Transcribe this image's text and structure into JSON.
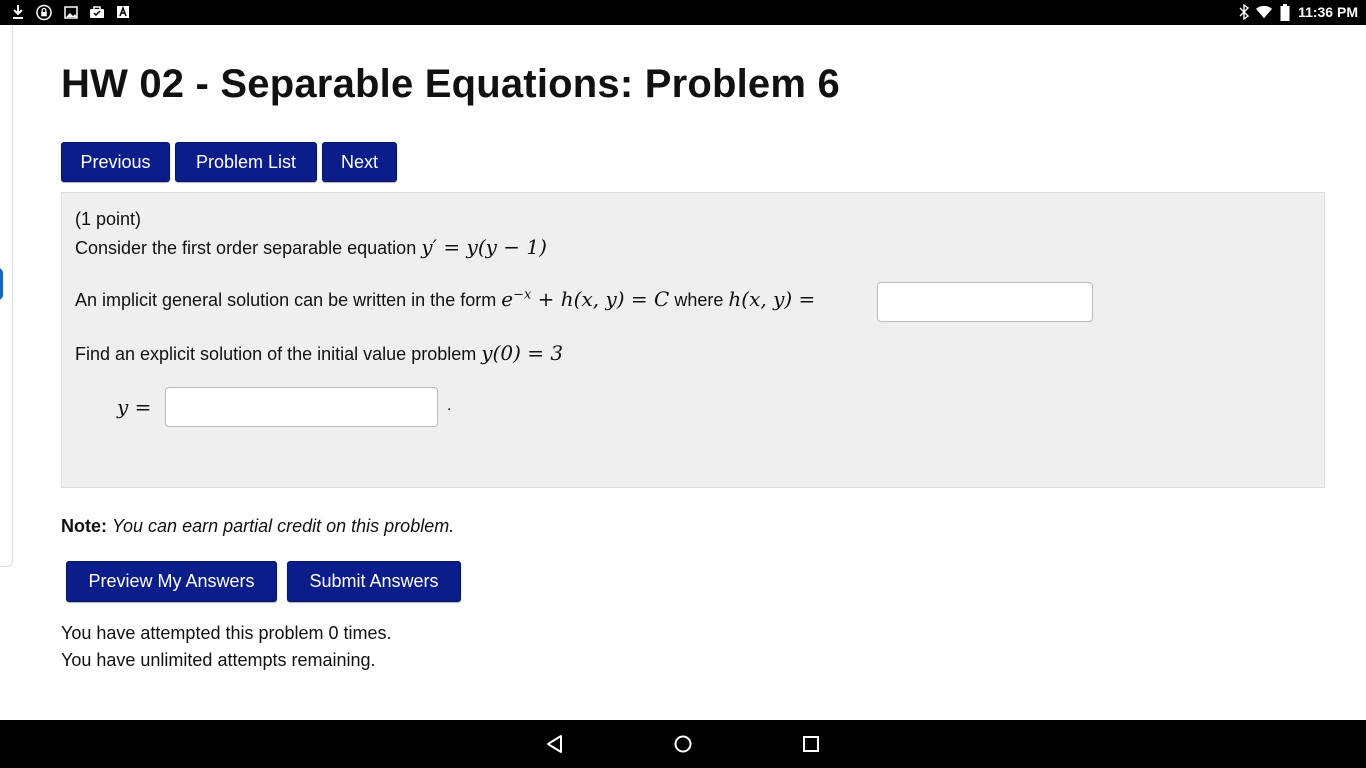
{
  "status_bar": {
    "time": "11:36 PM",
    "left_icons": [
      "download-icon",
      "vpn-lock-icon",
      "image-icon",
      "briefcase-icon",
      "text-a-icon"
    ],
    "right_icons": [
      "bluetooth-icon",
      "wifi-icon",
      "battery-icon"
    ]
  },
  "page": {
    "title": "HW 02 - Separable Equations: Problem 6"
  },
  "nav_buttons": {
    "previous": "Previous",
    "problem_list": "Problem List",
    "next": "Next"
  },
  "problem": {
    "points": "(1 point)",
    "line1_text": "Consider the first order separable equation",
    "line1_math": "y′ = y(y − 1)",
    "line2_text": "An implicit general solution can be written in the form",
    "line2_math_a": "e",
    "line2_math_exp": "−x",
    "line2_math_b": " + h(x, y) = C",
    "line2_where": "where",
    "line2_math_c": "h(x, y) =",
    "answer1_value": "",
    "line3_text": "Find an explicit solution of the initial value problem",
    "line3_math": "y(0) = 3",
    "answer2_label": "y =",
    "answer2_value": "",
    "answer2_trailing": "."
  },
  "note": {
    "label": "Note:",
    "text": "You can earn partial credit on this problem."
  },
  "action_buttons": {
    "preview": "Preview My Answers",
    "submit": "Submit Answers"
  },
  "attempts": {
    "line1": "You have attempted this problem 0 times.",
    "line2": "You have unlimited attempts remaining."
  },
  "nav_bar": {
    "icons": [
      "back-icon",
      "home-icon",
      "recents-icon"
    ]
  }
}
